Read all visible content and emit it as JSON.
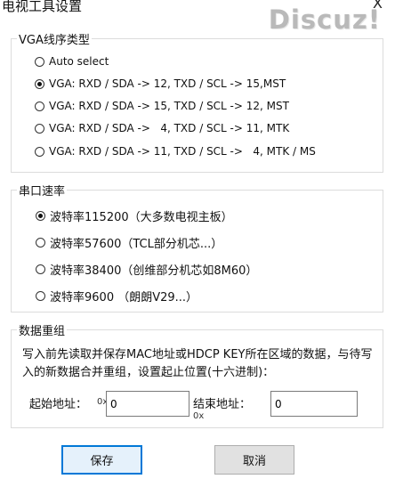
{
  "window": {
    "title": "电视工具设置",
    "close": "X"
  },
  "watermark": "Discuz!",
  "vga": {
    "legend": "VGA线序类型",
    "options": [
      {
        "label": "Auto select",
        "selected": false
      },
      {
        "label": "VGA: RXD / SDA -> 12, TXD / SCL -> 15,MST",
        "selected": true
      },
      {
        "label": "VGA: RXD / SDA -> 15, TXD / SCL -> 12, MST",
        "selected": false
      },
      {
        "label": "VGA: RXD / SDA ->   4, TXD / SCL -> 11, MTK",
        "selected": false
      },
      {
        "label": "VGA: RXD / SDA -> 11, TXD / SCL ->   4, MTK / MS",
        "selected": false
      }
    ]
  },
  "baud": {
    "legend": "串口速率",
    "options": [
      {
        "label": "波特率115200（大多数电视主板）",
        "selected": true
      },
      {
        "label": "波特率57600（TCL部分机芯...）",
        "selected": false
      },
      {
        "label": "波特率38400（创维部分机芯如8M60）",
        "selected": false
      },
      {
        "label": "波特率9600 （朗朗V29...）",
        "selected": false
      }
    ]
  },
  "regroup": {
    "legend": "数据重组",
    "description": "写入前先读取并保存MAC地址或HDCP KEY所在区域的数据，与待写入的新数据合并重组，设置起止位置(十六进制)：",
    "start_label": "起始地址：",
    "start_prefix": "0x",
    "start_value": "0",
    "end_label": "结束地址：",
    "end_prefix": "0x",
    "end_value": "0"
  },
  "buttons": {
    "save": "保存",
    "cancel": "取消"
  }
}
